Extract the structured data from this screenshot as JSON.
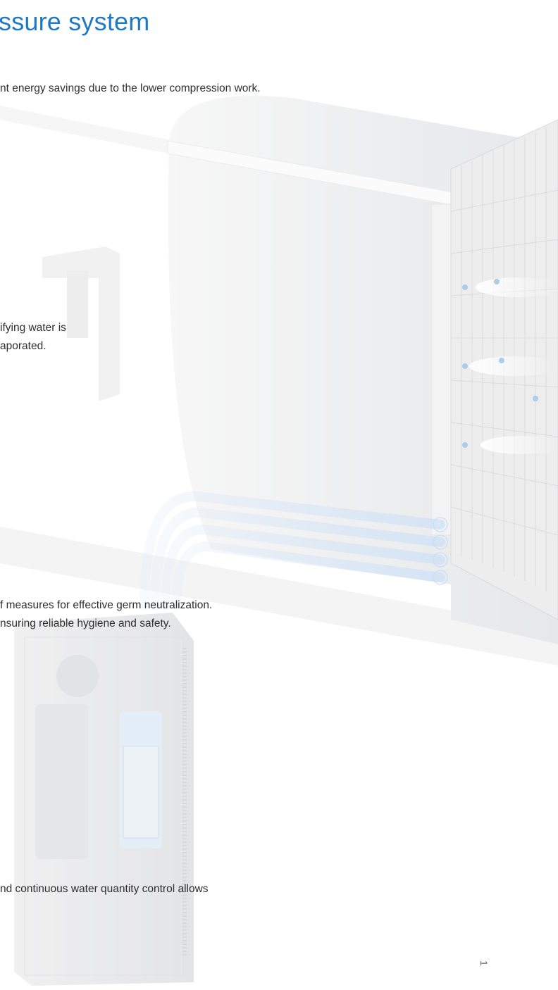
{
  "heading": "ssure system",
  "paragraphs": {
    "energy": "nt energy savings due to the lower compression work.",
    "water_line1": "ifying water is",
    "water_line2": "aporated.",
    "germ_line1": "f measures for effective germ neutralization.",
    "germ_line2": "nsuring reliable hygiene and safety.",
    "control": "nd continuous water quantity control allows"
  },
  "page_number": "1"
}
